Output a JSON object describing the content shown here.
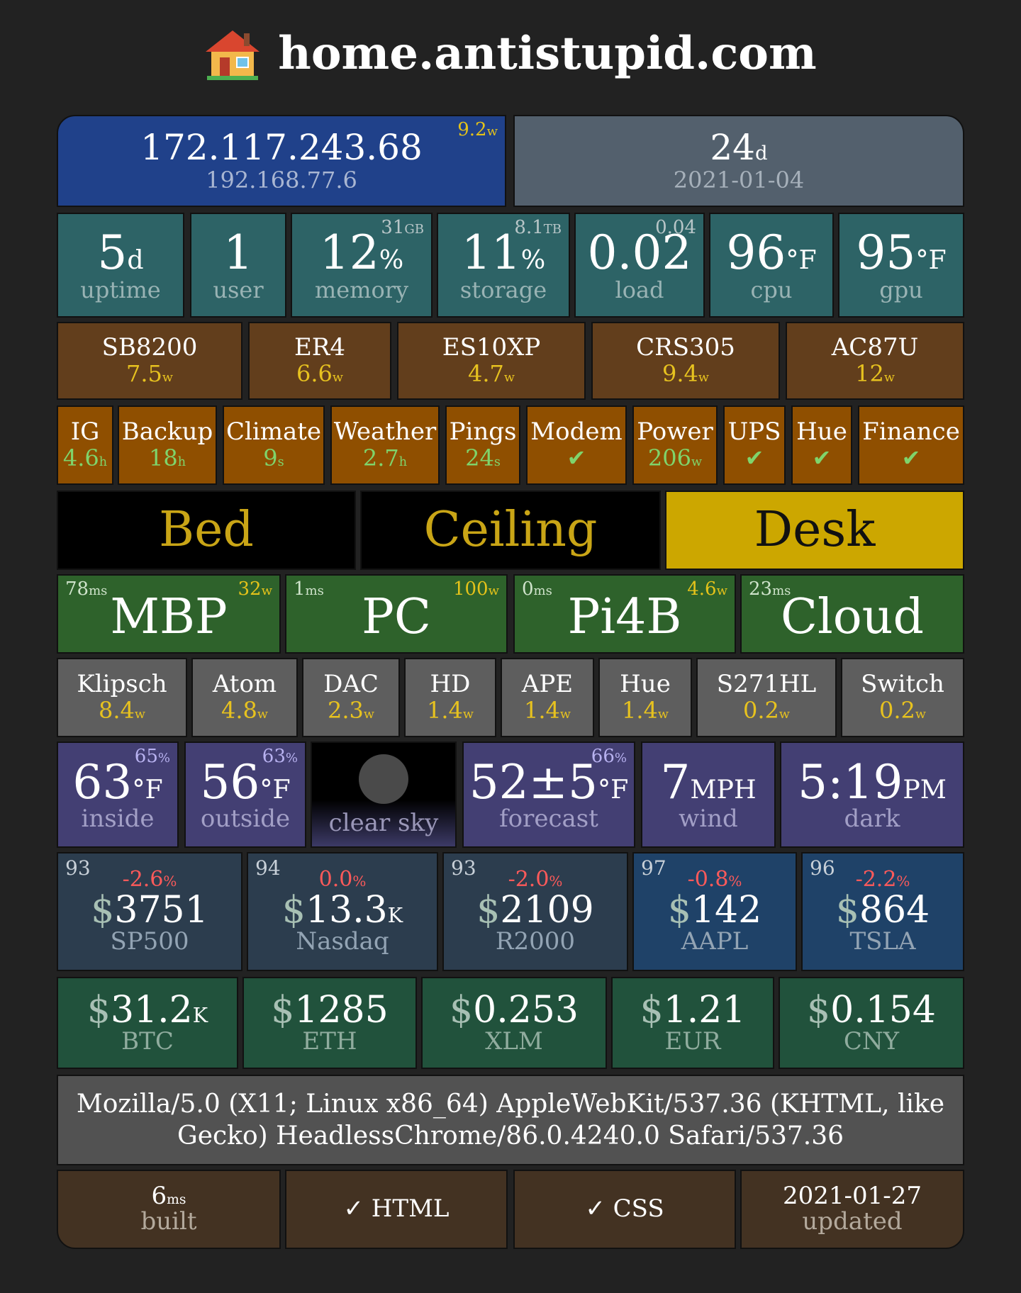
{
  "header": {
    "title": "home.antistupid.com",
    "icon": "house-icon"
  },
  "network": {
    "public_ip": "172.117.243.68",
    "local_ip": "192.168.77.6",
    "power": "9.2",
    "power_unit": "w"
  },
  "since": {
    "days": "24",
    "days_unit": "d",
    "date": "2021-01-04"
  },
  "stats": [
    {
      "value": "5",
      "unit": "d",
      "label": "uptime",
      "sup": "",
      "sup_unit": ""
    },
    {
      "value": "1",
      "unit": "",
      "label": "user",
      "sup": "",
      "sup_unit": ""
    },
    {
      "value": "12",
      "unit": "%",
      "label": "memory",
      "sup": "31",
      "sup_unit": "GB"
    },
    {
      "value": "11",
      "unit": "%",
      "label": "storage",
      "sup": "8.1",
      "sup_unit": "TB"
    },
    {
      "value": "0.02",
      "unit": "",
      "label": "load",
      "sup": "0.04",
      "sup_unit": ""
    },
    {
      "value": "96",
      "unit": "°F",
      "label": "cpu",
      "sup": "",
      "sup_unit": ""
    },
    {
      "value": "95",
      "unit": "°F",
      "label": "gpu",
      "sup": "",
      "sup_unit": ""
    }
  ],
  "devices": [
    {
      "name": "SB8200",
      "power": "7.5",
      "unit": "w"
    },
    {
      "name": "ER4",
      "power": "6.6",
      "unit": "w"
    },
    {
      "name": "ES10XP",
      "power": "4.7",
      "unit": "w"
    },
    {
      "name": "CRS305",
      "power": "9.4",
      "unit": "w"
    },
    {
      "name": "AC87U",
      "power": "12",
      "unit": "w"
    }
  ],
  "services": [
    {
      "name": "IG",
      "value": "4.6",
      "unit": "h"
    },
    {
      "name": "Backup",
      "value": "18",
      "unit": "h"
    },
    {
      "name": "Climate",
      "value": "9",
      "unit": "s"
    },
    {
      "name": "Weather",
      "value": "2.7",
      "unit": "h"
    },
    {
      "name": "Pings",
      "value": "24",
      "unit": "s"
    },
    {
      "name": "Modem",
      "value": "✔",
      "unit": ""
    },
    {
      "name": "Power",
      "value": "206",
      "unit": "w"
    },
    {
      "name": "UPS",
      "value": "✔",
      "unit": ""
    },
    {
      "name": "Hue",
      "value": "✔",
      "unit": ""
    },
    {
      "name": "Finance",
      "value": "✔",
      "unit": ""
    }
  ],
  "lights": [
    {
      "name": "Bed",
      "on": false
    },
    {
      "name": "Ceiling",
      "on": false
    },
    {
      "name": "Desk",
      "on": true
    }
  ],
  "hosts": [
    {
      "name": "MBP",
      "ping": "78",
      "ping_unit": "ms",
      "power": "32",
      "power_unit": "w"
    },
    {
      "name": "PC",
      "ping": "1",
      "ping_unit": "ms",
      "power": "100",
      "power_unit": "w"
    },
    {
      "name": "Pi4B",
      "ping": "0",
      "ping_unit": "ms",
      "power": "4.6",
      "power_unit": "w"
    },
    {
      "name": "Cloud",
      "ping": "23",
      "ping_unit": "ms",
      "power": "",
      "power_unit": ""
    }
  ],
  "peripherals": [
    {
      "name": "Klipsch",
      "power": "8.4",
      "unit": "w"
    },
    {
      "name": "Atom",
      "power": "4.8",
      "unit": "w"
    },
    {
      "name": "DAC",
      "power": "2.3",
      "unit": "w"
    },
    {
      "name": "HD",
      "power": "1.4",
      "unit": "w"
    },
    {
      "name": "APE",
      "power": "1.4",
      "unit": "w"
    },
    {
      "name": "Hue",
      "power": "1.4",
      "unit": "w"
    },
    {
      "name": "S271HL",
      "power": "0.2",
      "unit": "w"
    },
    {
      "name": "Switch",
      "power": "0.2",
      "unit": "w"
    }
  ],
  "weather": {
    "inside": {
      "value": "63",
      "unit": "°F",
      "label": "inside",
      "humidity": "65",
      "humidity_unit": "%"
    },
    "outside": {
      "value": "56",
      "unit": "°F",
      "label": "outside",
      "humidity": "63",
      "humidity_unit": "%"
    },
    "sky": {
      "label": "clear sky",
      "icon": "moon-icon"
    },
    "forecast": {
      "value": "52±5",
      "unit": "°F",
      "label": "forecast",
      "humidity": "66",
      "humidity_unit": "%"
    },
    "wind": {
      "value": "7",
      "unit": "MPH",
      "label": "wind"
    },
    "dark": {
      "value": "5:19",
      "unit": "PM",
      "label": "dark"
    }
  },
  "stocks": [
    {
      "rank": "93",
      "change": "-2.6",
      "change_unit": "%",
      "currency": "$",
      "value": "3751",
      "suffix": "",
      "name": "SP500"
    },
    {
      "rank": "94",
      "change": "0.0",
      "change_unit": "%",
      "currency": "$",
      "value": "13.3",
      "suffix": "K",
      "name": "Nasdaq"
    },
    {
      "rank": "93",
      "change": "-2.0",
      "change_unit": "%",
      "currency": "$",
      "value": "2109",
      "suffix": "",
      "name": "R2000"
    },
    {
      "rank": "97",
      "change": "-0.8",
      "change_unit": "%",
      "currency": "$",
      "value": "142",
      "suffix": "",
      "name": "AAPL"
    },
    {
      "rank": "96",
      "change": "-2.2",
      "change_unit": "%",
      "currency": "$",
      "value": "864",
      "suffix": "",
      "name": "TSLA"
    }
  ],
  "currencies": [
    {
      "currency": "$",
      "value": "31.2",
      "suffix": "K",
      "name": "BTC"
    },
    {
      "currency": "$",
      "value": "1285",
      "suffix": "",
      "name": "ETH"
    },
    {
      "currency": "$",
      "value": "0.253",
      "suffix": "",
      "name": "XLM"
    },
    {
      "currency": "$",
      "value": "1.21",
      "suffix": "",
      "name": "EUR"
    },
    {
      "currency": "$",
      "value": "0.154",
      "suffix": "",
      "name": "CNY"
    }
  ],
  "user_agent": "Mozilla/5.0 (X11; Linux x86_64) AppleWebKit/537.36 (KHTML, like Gecko) HeadlessChrome/86.0.4240.0 Safari/537.36",
  "footer": {
    "built": {
      "value": "6",
      "unit": "ms",
      "label": "built"
    },
    "html": "✓ HTML",
    "css": "✓ CSS",
    "updated": {
      "value": "2021-01-27",
      "label": "updated"
    }
  },
  "colors": {
    "background": "#222222",
    "network": "#20418a",
    "since": "#53606d",
    "stats": "#2d6366",
    "devices": "#623e1c",
    "services": "#8f4f00",
    "light_off": "#000000",
    "light_on": "#cca700",
    "light_text": "#c9a516",
    "hosts": "#2e622b",
    "peripherals": "#5e5e5e",
    "weather": "#433f73",
    "stocks_index": "#2c3d4e",
    "stocks_equity": "#1f4268",
    "currencies": "#21523c",
    "user_agent": "#525252",
    "footer": "#433222",
    "power_text": "#e7c21f",
    "service_text": "#7fd46b",
    "negative": "#ff5a5a"
  }
}
